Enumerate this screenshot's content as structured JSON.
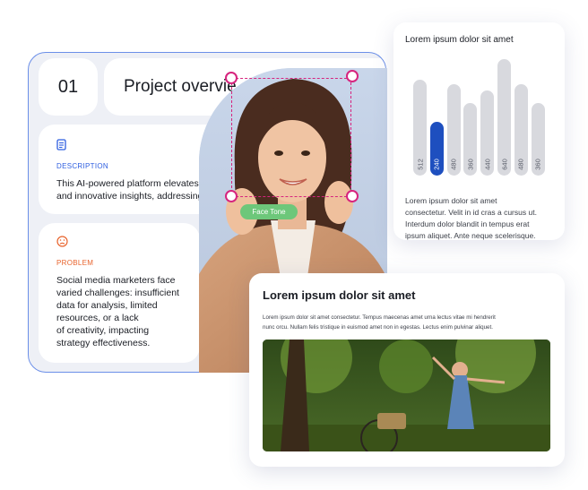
{
  "project": {
    "number": "01",
    "title": "Project overvie"
  },
  "description": {
    "label": "DESCRIPTION",
    "line1": "This AI-powered platform elevates S",
    "line2": "and innovative insights,  addressing"
  },
  "problem": {
    "label": "PROBLEM",
    "text_lines": [
      "Social media marketers face",
      "varied challenges: insufficient",
      "data for analysis, limited",
      "resources, or a lack",
      "of creativity, impacting",
      "strategy effectiveness."
    ]
  },
  "face_tool": {
    "tag_label": "Face Tone"
  },
  "chart_card": {
    "title": "Lorem ipsum dolor sit amet",
    "text_lines": [
      "Lorem ipsum dolor sit amet",
      "consectetur. Velit in id cras a cursus ut.",
      "Interdum dolor blandit in tempus erat",
      "ipsum aliquet. Ante neque scelerisque."
    ],
    "colors": {
      "active": "#1e4fbf",
      "inactive": "#d8d9de"
    }
  },
  "chart_data": {
    "type": "bar",
    "title": "Lorem ipsum dolor sit amet",
    "categories": [
      "",
      "",
      "",
      "",
      "",
      "",
      "",
      ""
    ],
    "values": [
      512,
      240,
      480,
      360,
      440,
      640,
      480,
      360
    ],
    "highlighted_index": 1,
    "ylim": [
      0,
      700
    ],
    "grid": false
  },
  "article": {
    "title": "Lorem ipsum dolor sit amet",
    "text_line1": "Lorem ipsum dolor sit amet consectetur. Tempus maecenas amet urna lectus vitae mi hendrerit",
    "text_line2": "nunc orcu. Nullam felis tristique in euismod amet non in egestas. Lectus enim pulvinar aliquet."
  },
  "icons": {
    "description": "document-icon",
    "problem": "sad-face-icon"
  }
}
